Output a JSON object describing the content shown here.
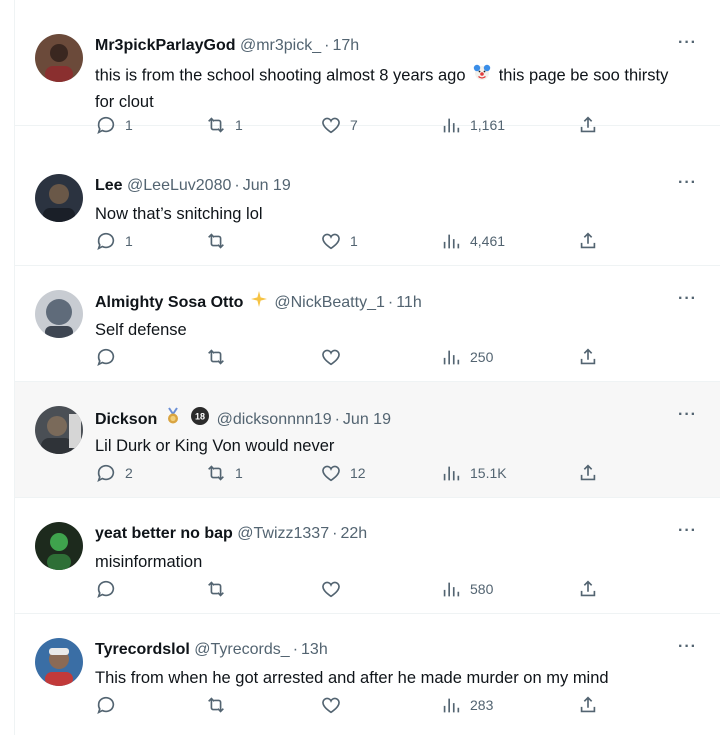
{
  "replies": [
    {
      "display_name": "Mr3pickParlayGod",
      "handle": "@mr3pick_",
      "time": "17h",
      "text_before": "this is from the school shooting almost 8 years ago",
      "emoji_icon": "clown-face-icon",
      "text_after": " this page be soo thirsty for clout",
      "replies": "1",
      "reposts": "1",
      "likes": "7",
      "views": "1,161",
      "avatar_color": "#6b4a3a"
    },
    {
      "display_name": "Lee",
      "handle": "@LeeLuv2080",
      "time": "Jun 19",
      "text": "Now that’s snitching lol",
      "replies": "1",
      "reposts": "",
      "likes": "1",
      "views": "4,461",
      "avatar_color": "#2b3340"
    },
    {
      "display_name": "Almighty Sosa Otto",
      "name_icon": "sparkles-icon",
      "handle": "@NickBeatty_1",
      "time": "11h",
      "text": "Self defense",
      "replies": "",
      "reposts": "",
      "likes": "",
      "views": "250",
      "avatar_color": "#5f6b7a"
    },
    {
      "display_name": "Dickson",
      "name_icon": "medal-icon",
      "badge_icon": "circle-18-badge-icon",
      "badge_text": "18",
      "handle": "@dicksonnnn19",
      "time": "Jun 19",
      "text": "Lil Durk or King Von would never",
      "replies": "2",
      "reposts": "1",
      "likes": "12",
      "views": "15.1K",
      "avatar_color": "#4a4f55"
    },
    {
      "display_name": "yeat better no bap",
      "handle": "@Twizz1337",
      "time": "22h",
      "text": "misinformation",
      "replies": "",
      "reposts": "",
      "likes": "",
      "views": "580",
      "avatar_color": "#1d2a1d"
    },
    {
      "display_name": "Tyrecordslol",
      "handle": "@Tyrecords_",
      "time": "13h",
      "text": "This from when he got arrested and after he made murder on my mind",
      "replies": "",
      "reposts": "",
      "likes": "",
      "views": "283",
      "avatar_color": "#3a6ea5"
    }
  ],
  "more_label": "···",
  "colors": {
    "text": "#0f1419",
    "secondary": "#536471",
    "divider": "#eff3f4",
    "sparkle": "#f6c343",
    "medal": "#d9a441"
  }
}
